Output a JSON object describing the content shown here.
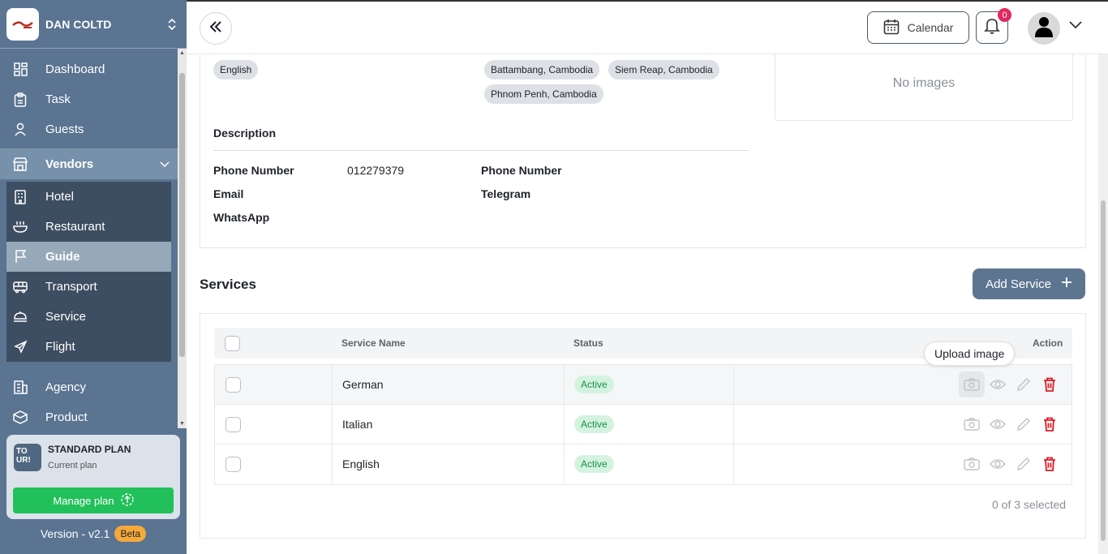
{
  "org": {
    "name": "DAN COLTD"
  },
  "nav": {
    "dashboard": "Dashboard",
    "task": "Task",
    "guests": "Guests",
    "vendors": "Vendors",
    "vendor_items": [
      "Hotel",
      "Restaurant",
      "Guide",
      "Transport",
      "Service",
      "Flight"
    ],
    "agency": "Agency",
    "product": "Product"
  },
  "plan": {
    "icon_text": "TO UR!",
    "title": "STANDARD PLAN",
    "subtitle": "Current plan",
    "manage_label": "Manage plan"
  },
  "version": {
    "label": "Version - v2.1",
    "badge": "Beta"
  },
  "header": {
    "calendar_label": "Calendar",
    "notification_count": "0"
  },
  "details": {
    "languages": [
      "English"
    ],
    "locations": [
      "Battambang, Cambodia",
      "Siem Reap, Cambodia",
      "Phnom Penh, Cambodia"
    ],
    "no_images": "No images",
    "description_label": "Description",
    "phone_label": "Phone Number",
    "phone_value": "012279379",
    "phone2_label": "Phone Number",
    "email_label": "Email",
    "telegram_label": "Telegram",
    "whatsapp_label": "WhatsApp"
  },
  "services": {
    "title": "Services",
    "add_label": "Add Service",
    "columns": {
      "name": "Service Name",
      "status": "Status",
      "action": "Action"
    },
    "rows": [
      {
        "name": "German",
        "status": "Active"
      },
      {
        "name": "Italian",
        "status": "Active"
      },
      {
        "name": "English",
        "status": "Active"
      }
    ],
    "tooltip": "Upload image",
    "selected_text": "0 of 3 selected"
  },
  "colors": {
    "sidebar": "#5a7491",
    "active_badge_bg": "#d3f3e0",
    "active_badge_text": "#18904a",
    "delete": "#e01b24",
    "manage_button": "#21c05a"
  }
}
